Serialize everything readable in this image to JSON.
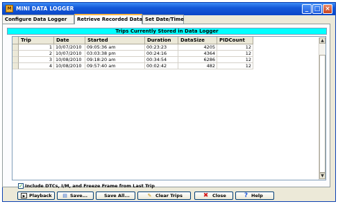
{
  "window": {
    "title": "MINI DATA LOGGER",
    "icon": "app-logo-icon"
  },
  "tabs": [
    {
      "label": "Configure Data Logger"
    },
    {
      "label": "Retrieve Recorded Data"
    },
    {
      "label": "Set Date/Time"
    }
  ],
  "caption": "Trips Currently Stored in Data Logger",
  "table": {
    "columns": [
      "Trip",
      "Date",
      "Started",
      "Duration",
      "DataSize",
      "PIDCount"
    ],
    "rows": [
      [
        "1",
        "10/07/2010",
        "09:05:36 am",
        "00:23:23",
        "4205",
        "12"
      ],
      [
        "2",
        "10/07/2010",
        "03:03:38 pm",
        "00:24:16",
        "4364",
        "12"
      ],
      [
        "3",
        "10/08/2010",
        "09:18:20 am",
        "00:34:54",
        "6286",
        "12"
      ],
      [
        "4",
        "10/08/2010",
        "09:57:40 am",
        "00:02:42",
        "482",
        "12"
      ]
    ]
  },
  "include_checkbox": {
    "label": "Include DTCs, I/M, and Freeze Frame from Last Trip",
    "checked": true
  },
  "buttons": {
    "playback": "Playback",
    "save": "Save...",
    "save_all": "Save All...",
    "clear_trips": "Clear Trips",
    "close": "Close",
    "help": "Help"
  },
  "colors": {
    "caption_bg": "#00ffff",
    "titlebar": "#0a46c8"
  }
}
